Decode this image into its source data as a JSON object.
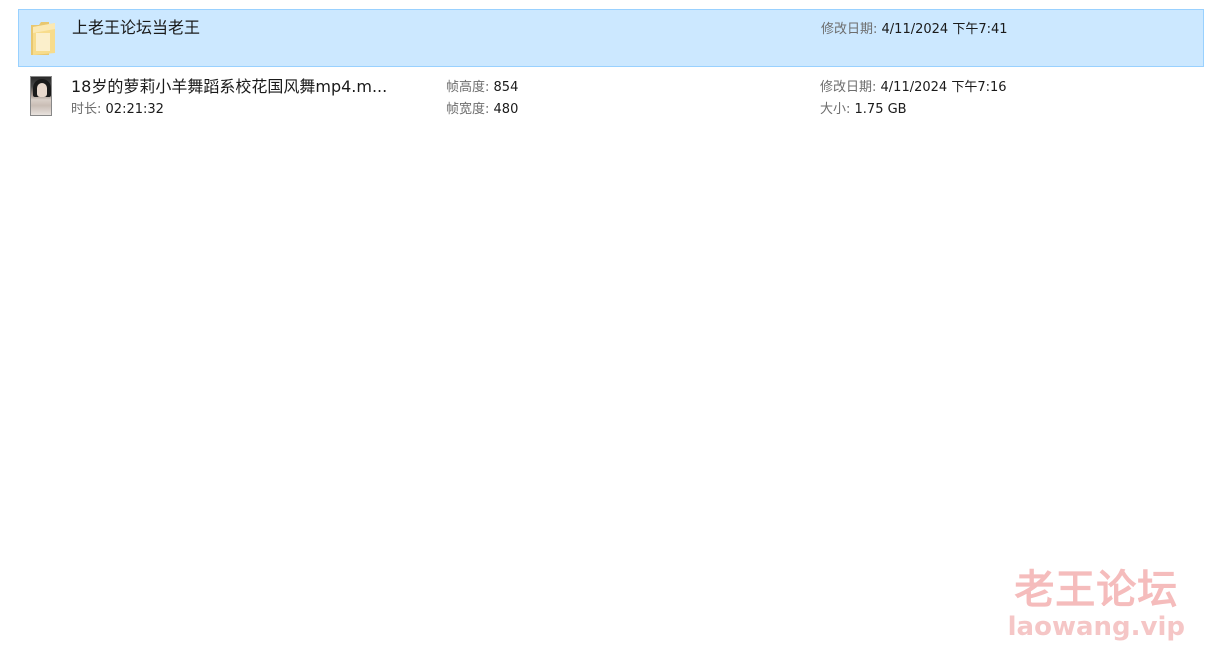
{
  "items": [
    {
      "name": "上老王论坛当老王",
      "icon": "folder-icon",
      "modified_label": "修改日期:",
      "modified_value": "4/11/2024 下午7:41"
    },
    {
      "name": "18岁的萝莉小羊舞蹈系校花国风舞mp4.m...",
      "icon": "video-thumbnail-icon",
      "duration_label": "时长:",
      "duration_value": "02:21:32",
      "frame_height_label": "帧高度:",
      "frame_height_value": "854",
      "frame_width_label": "帧宽度:",
      "frame_width_value": "480",
      "modified_label": "修改日期:",
      "modified_value": "4/11/2024 下午7:16",
      "size_label": "大小:",
      "size_value": "1.75 GB"
    }
  ],
  "watermark": {
    "cn": "老王论坛",
    "en": "laowang.vip"
  },
  "colors": {
    "selection_bg": "#cce8ff",
    "selection_border": "#99d1ff",
    "label_gray": "#6d6d6d",
    "watermark_pink": "#f5bcbc"
  }
}
